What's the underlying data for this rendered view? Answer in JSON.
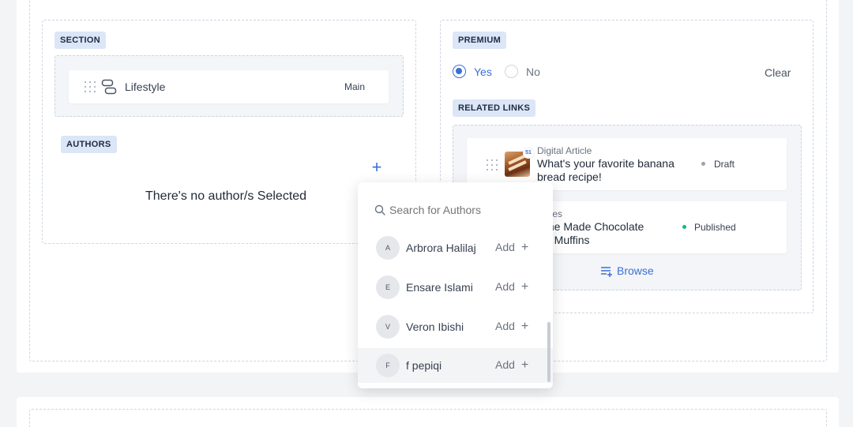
{
  "section": {
    "tag": "SECTION",
    "item": {
      "label": "Lifestyle",
      "badge": "Main"
    }
  },
  "authors": {
    "tag": "AUTHORS",
    "empty_message": "There's no author/s Selected",
    "add_symbol": "+"
  },
  "premium": {
    "tag": "PREMIUM",
    "options": [
      {
        "label": "Yes",
        "selected": true
      },
      {
        "label": "No",
        "selected": false
      }
    ],
    "clear_label": "Clear"
  },
  "related_links": {
    "tag": "RELATED LINKS",
    "items": [
      {
        "type": "Digital Article",
        "title_line1": "What's your favorite banana",
        "title_line2": "bread recipe!",
        "status": "Draft",
        "status_color": "#9ca3af",
        "thumb_badge": "51"
      },
      {
        "type": "ipes",
        "title_line1": "me Made Chocolate",
        "title_line2": "p Muffins",
        "status": "Published",
        "status_color": "#10b981"
      }
    ],
    "browse_label": "Browse"
  },
  "author_search": {
    "placeholder": "Search for Authors",
    "add_label": "Add",
    "add_symbol": "+",
    "results": [
      {
        "initial": "A",
        "name": "Arbrora Halilaj"
      },
      {
        "initial": "E",
        "name": "Ensare Islami"
      },
      {
        "initial": "V",
        "name": "Veron Ibishi"
      },
      {
        "initial": "F",
        "name": "f pepiqi"
      }
    ]
  },
  "colors": {
    "accent": "#3b6fd8",
    "tag_bg": "#dbe6f7",
    "published": "#10b981",
    "draft": "#9ca3af"
  }
}
